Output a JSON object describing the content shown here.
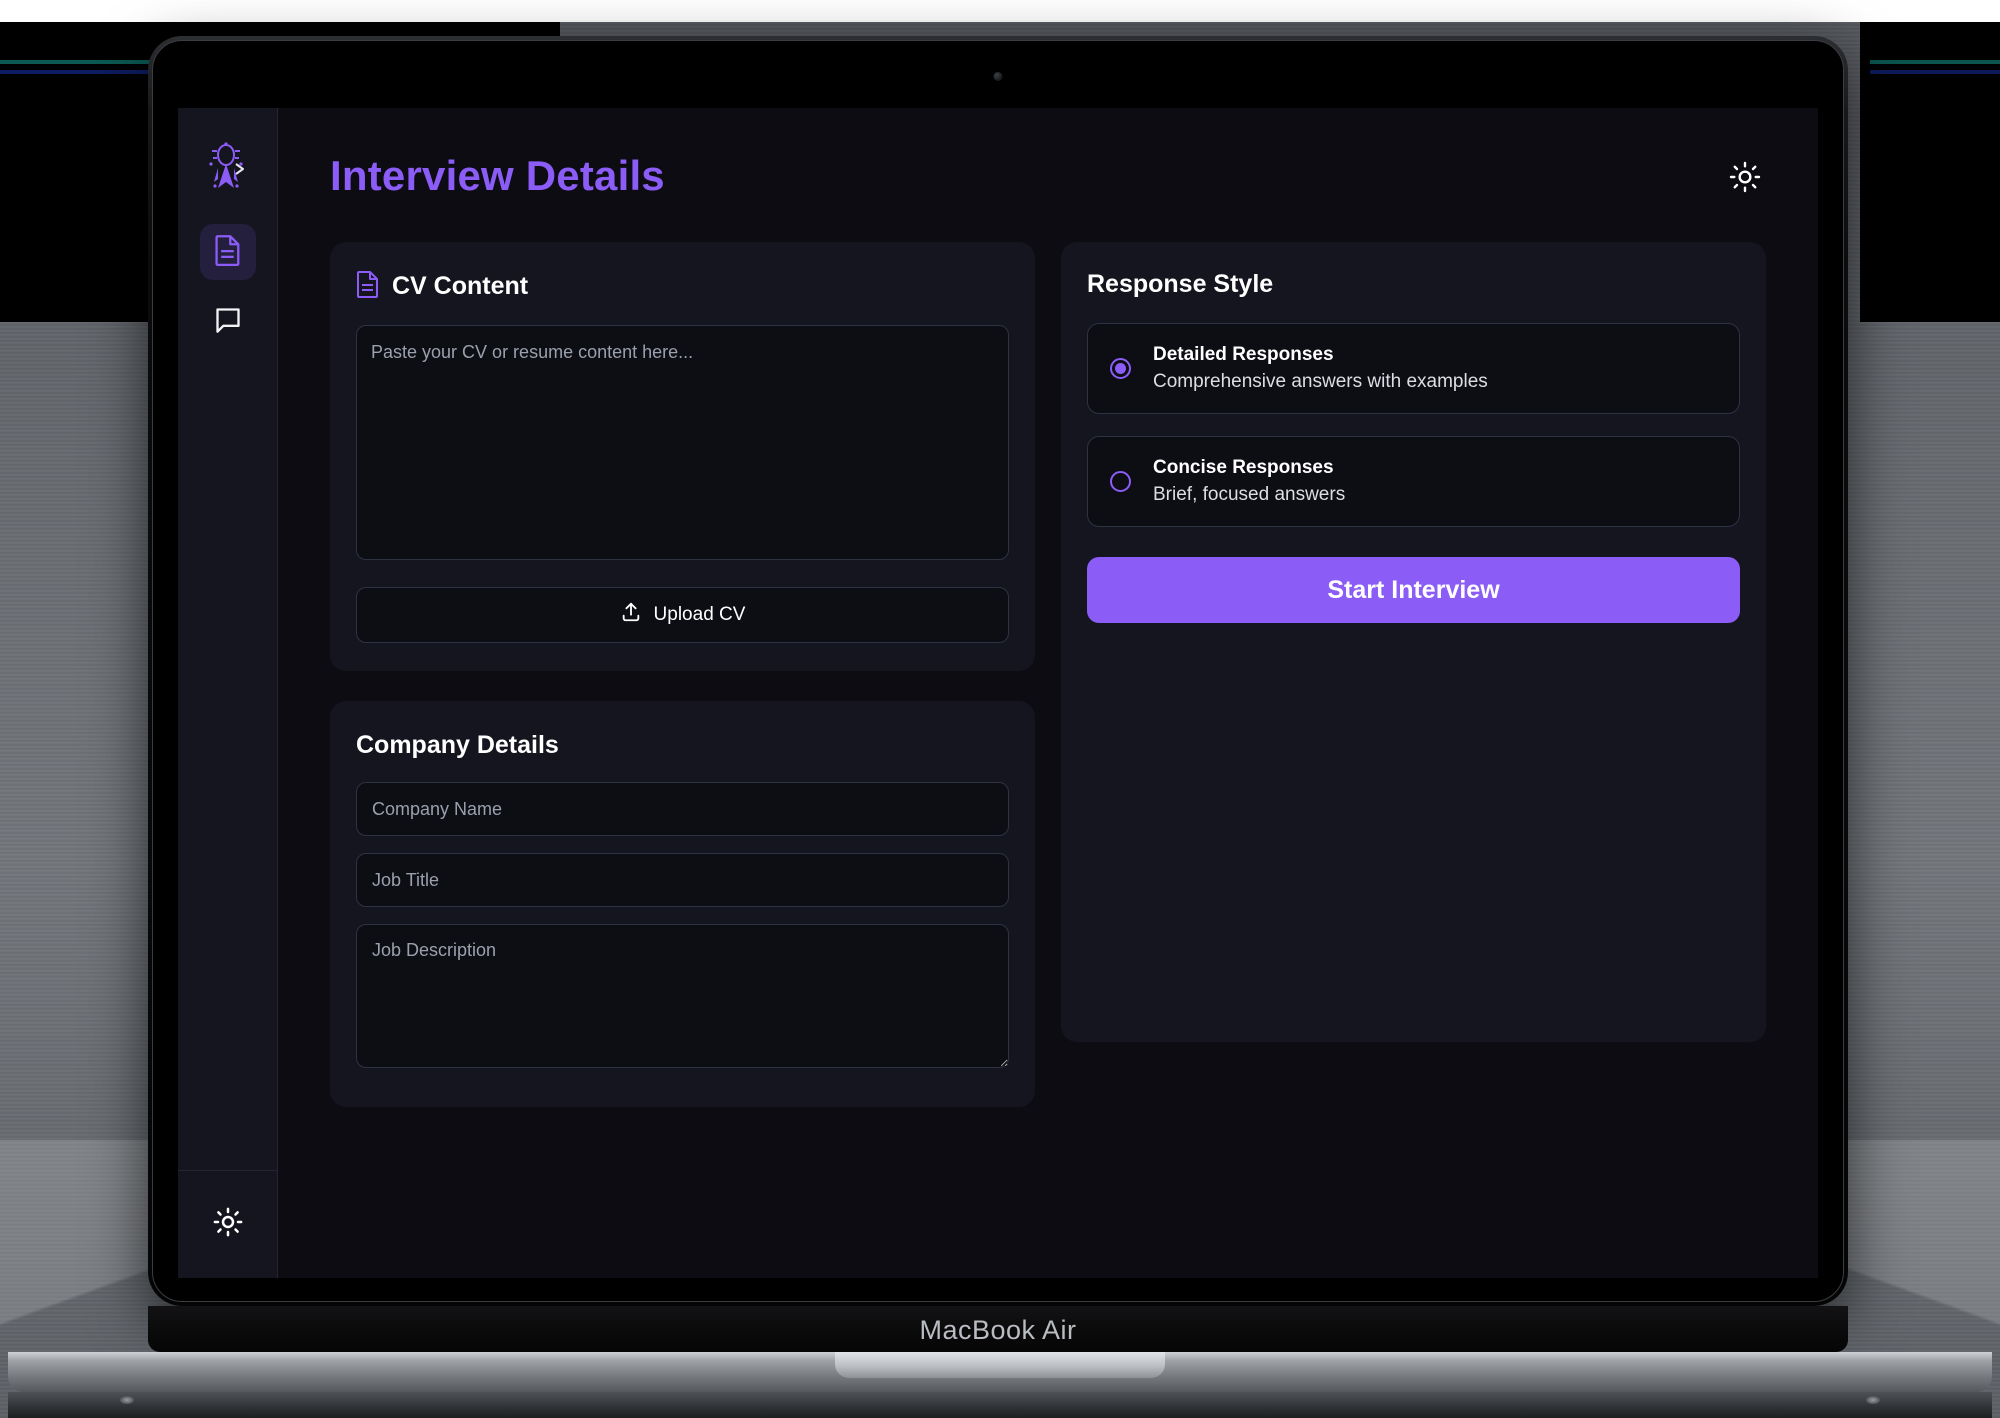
{
  "device": {
    "model_label": "MacBook Air"
  },
  "sidebar": {
    "logo_icon": "rocket-sparkle-logo-icon",
    "items": [
      {
        "icon": "document-icon",
        "name": "interview-details",
        "active": true
      },
      {
        "icon": "chat-bubble-icon",
        "name": "chat",
        "active": false
      }
    ],
    "bottom": {
      "icon": "sun-icon",
      "name": "theme-toggle"
    }
  },
  "header": {
    "title": "Interview Details",
    "theme_toggle_icon": "sun-icon"
  },
  "cv_card": {
    "icon": "document-icon",
    "title": "CV Content",
    "textarea_placeholder": "Paste your CV or resume content here...",
    "textarea_value": "",
    "upload_label": "Upload CV",
    "upload_icon": "upload-icon"
  },
  "company_card": {
    "title": "Company Details",
    "fields": [
      {
        "name": "company-name",
        "placeholder": "Company Name",
        "value": ""
      },
      {
        "name": "job-title",
        "placeholder": "Job Title",
        "value": ""
      },
      {
        "name": "job-description",
        "placeholder": "Job Description",
        "value": ""
      }
    ]
  },
  "response_style": {
    "title": "Response Style",
    "options": [
      {
        "label": "Detailed Responses",
        "description": "Comprehensive answers with examples",
        "selected": true
      },
      {
        "label": "Concise Responses",
        "description": "Brief, focused answers",
        "selected": false
      }
    ],
    "start_label": "Start Interview"
  },
  "colors": {
    "accent": "#8b5cf6",
    "page_bg": "#0c0c12",
    "card_bg": "#15151f",
    "field_bg": "#0d0d14",
    "border": "#2d3343"
  }
}
